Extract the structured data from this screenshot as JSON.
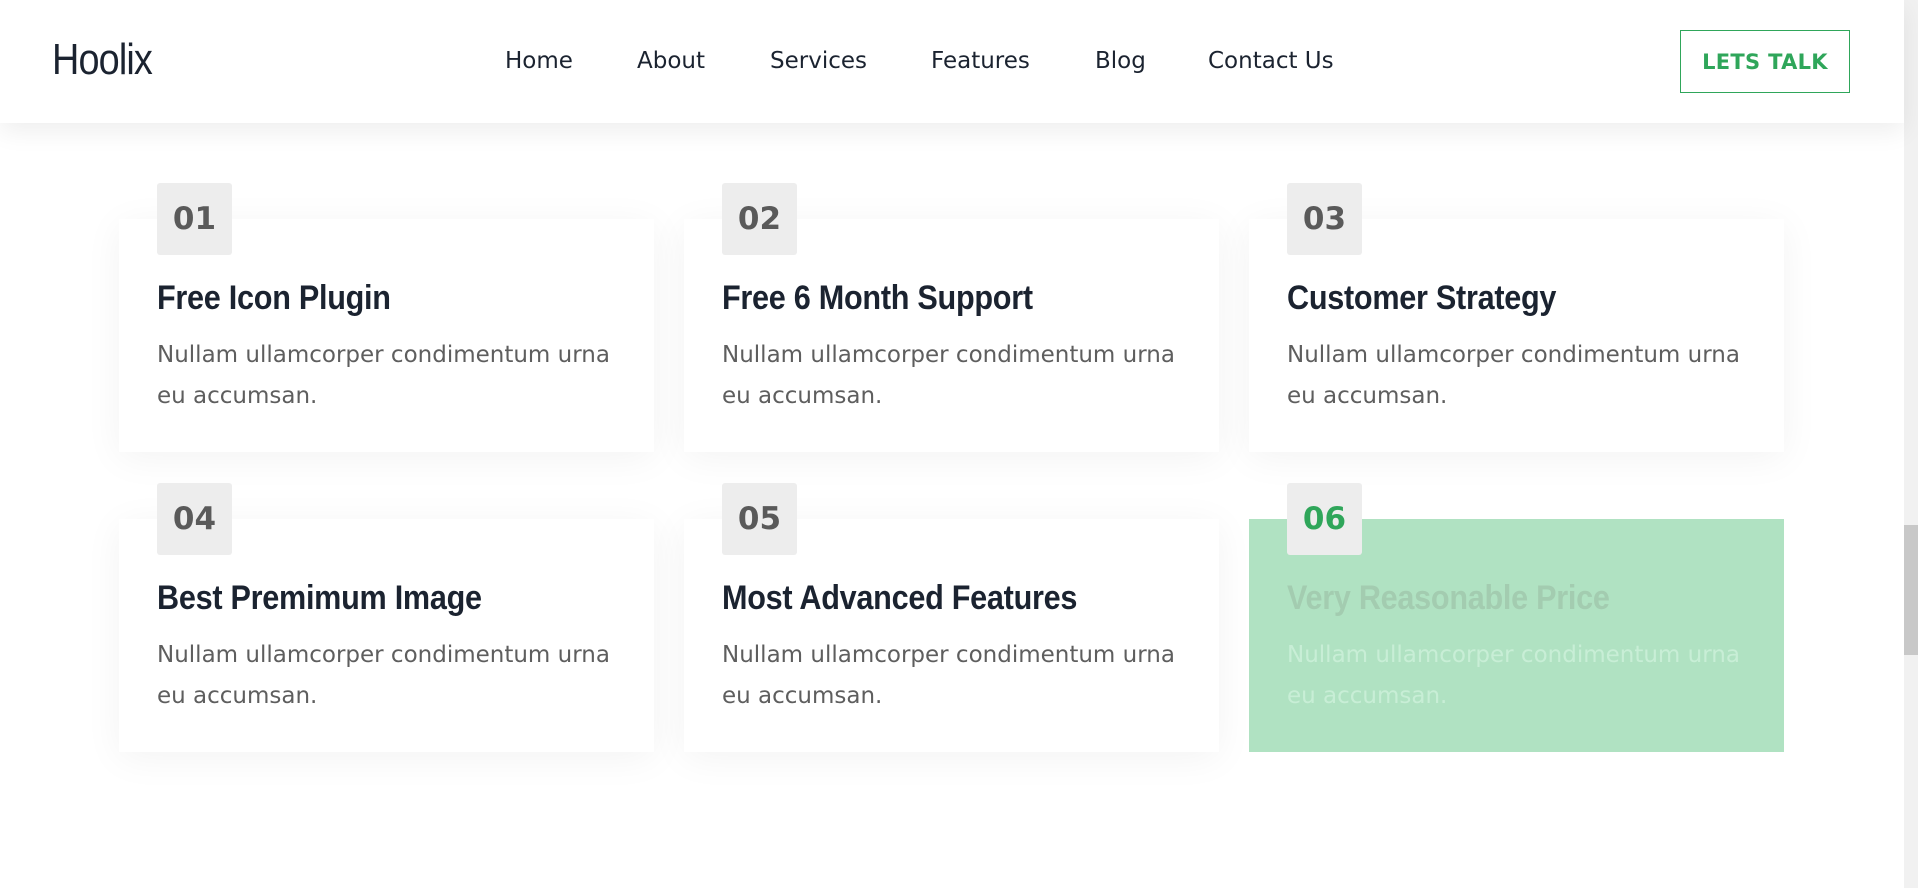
{
  "header": {
    "logo": "Hoolix",
    "nav": [
      {
        "label": "Home"
      },
      {
        "label": "About"
      },
      {
        "label": "Services"
      },
      {
        "label": "Features"
      },
      {
        "label": "Blog"
      },
      {
        "label": "Contact Us"
      }
    ],
    "cta_label": "LETS TALK"
  },
  "features": [
    {
      "number": "01",
      "title": "Free Icon Plugin",
      "description": "Nullam ullamcorper condimentum urna eu accumsan."
    },
    {
      "number": "02",
      "title": "Free 6 Month Support",
      "description": "Nullam ullamcorper condimentum urna eu accumsan."
    },
    {
      "number": "03",
      "title": "Customer Strategy",
      "description": "Nullam ullamcorper condimentum urna eu accumsan."
    },
    {
      "number": "04",
      "title": "Best Premimum Image",
      "description": "Nullam ullamcorper condimentum urna eu accumsan."
    },
    {
      "number": "05",
      "title": "Most Advanced Features",
      "description": "Nullam ullamcorper condimentum urna eu accumsan."
    },
    {
      "number": "06",
      "title": "Very Reasonable Price",
      "description": "Nullam ullamcorper condimentum urna eu accumsan."
    }
  ],
  "colors": {
    "accent": "#2fa65a",
    "active_card_bg": "#b0e2c2",
    "number_badge_bg": "#ededed",
    "heading": "#1b2330",
    "body_text": "#5e5e5e"
  }
}
